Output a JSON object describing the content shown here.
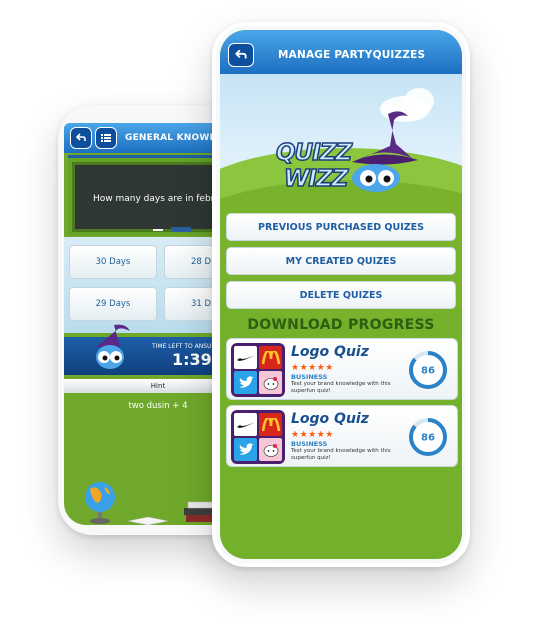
{
  "back_phone": {
    "header": {
      "title": "GENERAL KNOWLEDG"
    },
    "question": "How many days are in febru",
    "answers": [
      "30 Days",
      "28 D",
      "29 Days",
      "31 D"
    ],
    "timer": {
      "label": "TIME LEFT TO ANSU",
      "value": "1:39"
    },
    "hint": {
      "label": "Hint",
      "text": "two dusin + 4"
    }
  },
  "front_phone": {
    "header": {
      "title": "MANAGE PARTYQUIZZES"
    },
    "logo": {
      "line1": "QUIZZ",
      "line2": "WIZZ"
    },
    "menu": [
      {
        "label": "PREVIOUS PURCHASED QUIZES"
      },
      {
        "label": "MY CREATED QUIZES"
      },
      {
        "label": "DELETE QUIZES"
      }
    ],
    "section_title": "DOWNLOAD PROGRESS",
    "downloads": [
      {
        "title": "Logo Quiz",
        "stars": "★★★★★",
        "category": "BUSINESS",
        "description": "Test your brand knowledge with this superfun quiz!",
        "progress": 86,
        "progress_label": "86"
      },
      {
        "title": "Logo Quiz",
        "stars": "★★★★★",
        "category": "BUSINESS",
        "description": "Test your brand knowledge with this superfun quiz!",
        "progress": 86,
        "progress_label": "86"
      }
    ]
  },
  "colors": {
    "header_blue": "#1d6fc1",
    "grass_green": "#74b12b",
    "title_green": "#2f5d12",
    "button_text_blue": "#1e5ea2",
    "progress_blue": "#2a83c8",
    "star_orange": "#ff5a14",
    "wizard_purple": "#5b2a86"
  },
  "icons": [
    "back-arrow-icon",
    "menu-list-icon",
    "globe-icon",
    "books-icon",
    "wizard-mascot-icon",
    "nike-logo-icon",
    "mcdonalds-logo-icon",
    "twitter-logo-icon",
    "hello-kitty-logo-icon"
  ]
}
